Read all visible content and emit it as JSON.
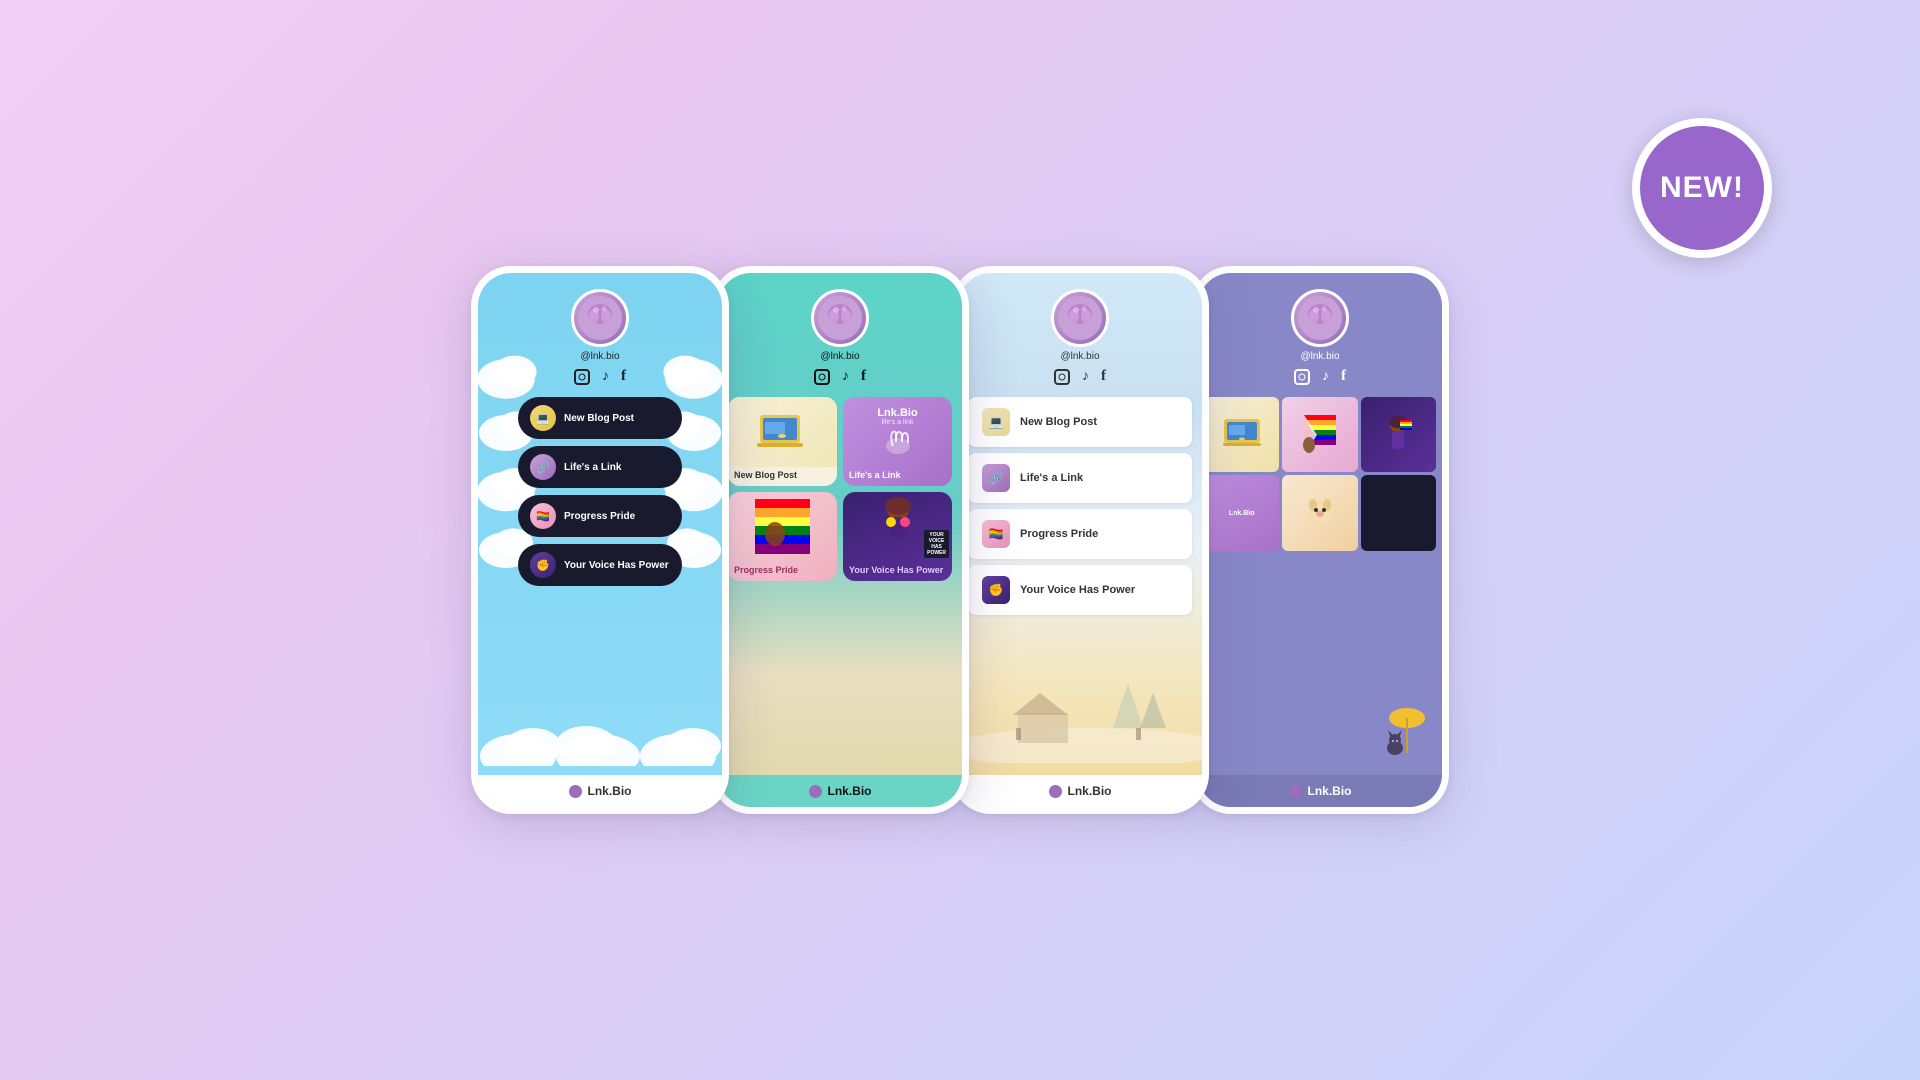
{
  "background": {
    "gradient_start": "#f0d6f5",
    "gradient_end": "#c8d4f8"
  },
  "new_badge": {
    "label": "NEW!",
    "bg_color": "#9966cc",
    "border_color": "white"
  },
  "shared": {
    "username": "@lnk.bio",
    "footer_label": "Lnk.Bio",
    "avatar_emoji": "🧠"
  },
  "phones": [
    {
      "id": "phone-1",
      "theme": "sky-blue",
      "bg": "#87d4f5",
      "username": "@lnk.bio",
      "links": [
        {
          "label": "New Blog Post",
          "icon": "💻"
        },
        {
          "label": "Life's a Link",
          "icon": "🔗"
        },
        {
          "label": "Progress Pride",
          "icon": "🏳️‍🌈"
        },
        {
          "label": "Your Voice Has Power",
          "icon": "✊"
        }
      ],
      "footer": "Lnk.Bio"
    },
    {
      "id": "phone-2",
      "theme": "teal",
      "bg": "#5dd4c8",
      "username": "@lnk.bio",
      "grid_items": [
        {
          "label": "New Blog Post",
          "color": "blog"
        },
        {
          "label": "Life's a Link",
          "color": "lnkbio"
        },
        {
          "label": "Progress Pride",
          "color": "pride"
        },
        {
          "label": "Your Voice Has Power",
          "color": "woman"
        }
      ],
      "footer": "Lnk.Bio"
    },
    {
      "id": "phone-3",
      "theme": "light-blue",
      "bg": "#d8ecf8",
      "username": "@lnk.bio",
      "links": [
        {
          "label": "New Blog Post"
        },
        {
          "label": "Life's a Link"
        },
        {
          "label": "Progress Pride"
        },
        {
          "label": "Your Voice Has Power"
        }
      ],
      "footer": "Lnk.Bio"
    },
    {
      "id": "phone-4",
      "theme": "lavender",
      "bg": "#8888c8",
      "username": "@lnk.bio",
      "grid_items": [
        {
          "color": "p4-1"
        },
        {
          "color": "p4-2"
        },
        {
          "color": "p4-3"
        },
        {
          "color": "p4-4",
          "label": "Lnk.Bio"
        },
        {
          "color": "p4-5"
        },
        {
          "color": "p4-6"
        }
      ],
      "footer": "Lnk.Bio"
    }
  ]
}
